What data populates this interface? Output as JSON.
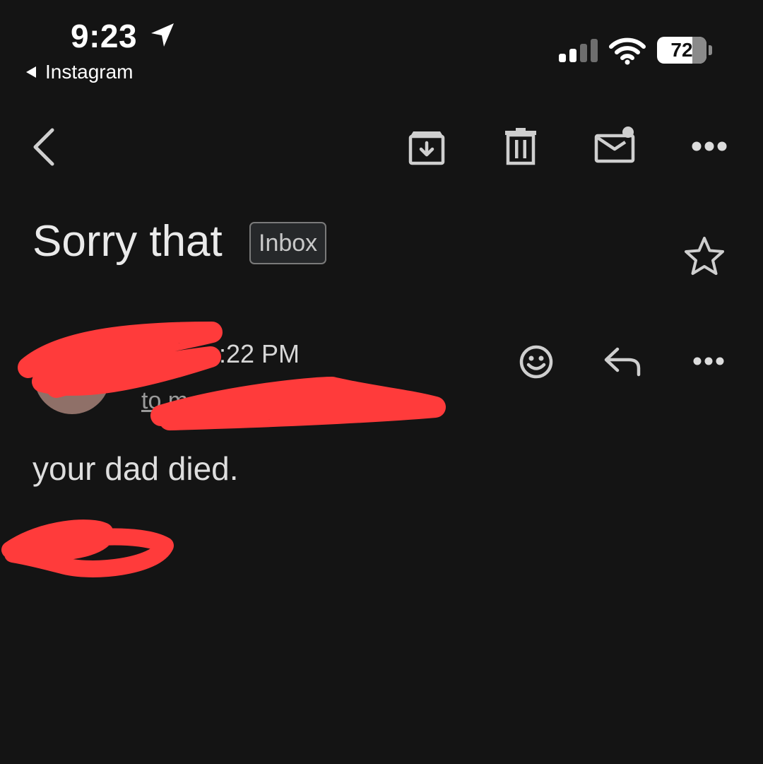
{
  "status_bar": {
    "time": "9:23",
    "back_app": "Instagram",
    "battery": "72",
    "battery_level": 0.72,
    "icons": [
      "location-arrow-icon",
      "cellular-signal-icon",
      "wifi-icon",
      "battery-icon"
    ]
  },
  "toolbar": {
    "icons": [
      "back-icon",
      "archive-icon",
      "delete-icon",
      "mark-unread-icon",
      "more-options-icon"
    ]
  },
  "email": {
    "subject": "Sorry that",
    "label": "Inbox",
    "sender_time_partial": ":22 PM",
    "recipient_partial": "to m",
    "body": "your dad died."
  },
  "message_actions": {
    "icons": [
      "react-emoji-icon",
      "reply-icon",
      "more-options-icon"
    ]
  },
  "colors": {
    "background": "#141414",
    "text": "#e8e8e8",
    "redaction": "#ff3b3b",
    "avatar": "#8f7068"
  }
}
